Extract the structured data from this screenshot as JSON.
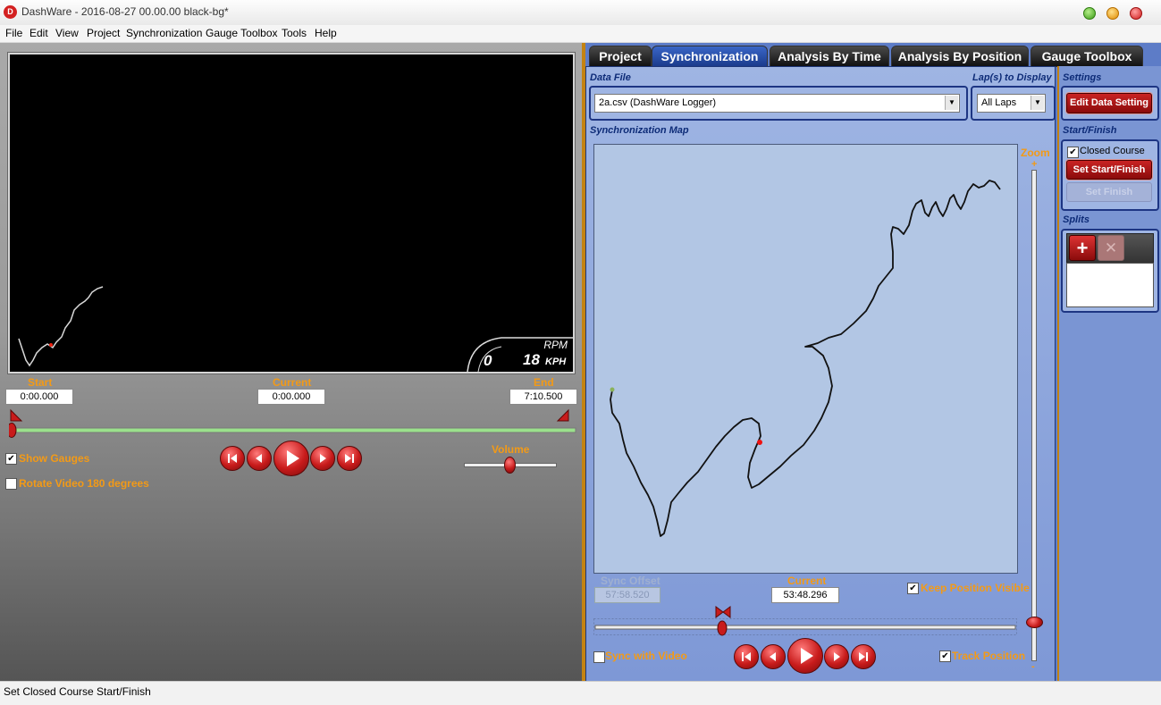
{
  "window": {
    "title": "DashWare - 2016-08-27 00.00.00 black-bg*",
    "app_icon": "D"
  },
  "menu": [
    "File",
    "Edit",
    "View",
    "Project",
    "Synchronization",
    "Gauge Toolbox",
    "Tools",
    "Help"
  ],
  "video": {
    "gauge_rpm_label": "RPM",
    "gauge_rpm_value": "0",
    "gauge_speed_value": "18",
    "gauge_speed_unit": "KPH",
    "start_label": "Start",
    "start_value": "0:00.000",
    "current_label": "Current",
    "current_value": "0:00.000",
    "end_label": "End",
    "end_value": "7:10.500",
    "volume_label": "Volume",
    "show_gauges_label": "Show Gauges",
    "show_gauges_checked": true,
    "rotate_label": "Rotate Video 180 degrees",
    "rotate_checked": false
  },
  "tabs": [
    {
      "label": "Project",
      "active": false
    },
    {
      "label": "Synchronization",
      "active": true
    },
    {
      "label": "Analysis By Time",
      "active": false
    },
    {
      "label": "Analysis By Position",
      "active": false
    },
    {
      "label": "Gauge Toolbox",
      "active": false
    }
  ],
  "sync": {
    "data_file_label": "Data File",
    "data_file_value": "2a.csv (DashWare Logger)",
    "laps_label": "Lap(s) to Display",
    "laps_value": "All Laps",
    "map_label": "Synchronization Map",
    "zoom_label": "Zoom",
    "zoom_plus": "+",
    "zoom_minus": "-",
    "sync_offset_label": "Sync Offset",
    "sync_offset_value": "57:58.520",
    "current_label": "Current",
    "current_value": "53:48.296",
    "keep_visible_label": "Keep Position Visible",
    "keep_visible_checked": true,
    "sync_video_label": "Sync with Video",
    "sync_video_checked": false,
    "track_position_label": "Track Position",
    "track_position_checked": true
  },
  "settings": {
    "settings_label": "Settings",
    "edit_button": "Edit Data Setting",
    "start_finish_label": "Start/Finish",
    "closed_course_label": "Closed Course",
    "closed_course_checked": true,
    "set_start_finish_button": "Set Start/Finish",
    "set_finish_button": "Set Finish",
    "splits_label": "Splits"
  },
  "status": {
    "text": "Set Closed Course Start/Finish"
  },
  "colors": {
    "accent_orange": "#f39a16",
    "panel_blue": "#5d7cc7",
    "button_red": "#c81b1b"
  }
}
